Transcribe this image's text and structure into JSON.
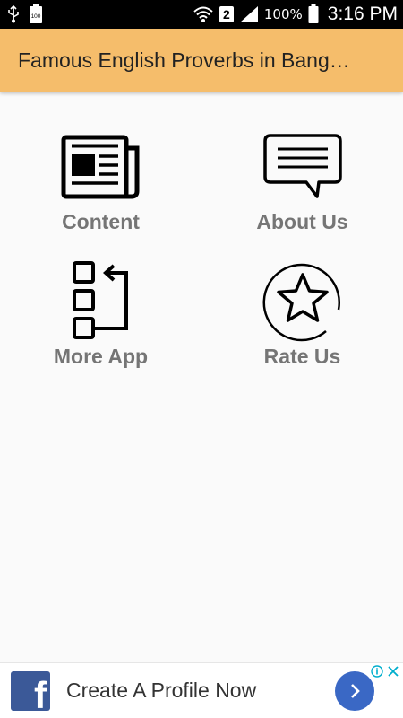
{
  "status_bar": {
    "left_icons": [
      "usb-icon",
      "battery-100-icon"
    ],
    "battery_small_label": "100",
    "sim_label": "2",
    "battery_percent": "100%",
    "time": "3:16 PM"
  },
  "app_bar": {
    "title": "Famous English Proverbs in Bang…",
    "background": "#f5bd6b"
  },
  "menu": {
    "items": [
      {
        "label": "Content",
        "icon": "newspaper-icon"
      },
      {
        "label": "About Us",
        "icon": "chat-bubble-icon"
      },
      {
        "label": "More App",
        "icon": "app-list-icon"
      },
      {
        "label": "Rate Us",
        "icon": "star-circle-icon"
      }
    ],
    "label_color": "#757575"
  },
  "ad": {
    "brand_letter": "f",
    "text": "Create A Profile Now",
    "brand_color": "#3b5998",
    "cta_color": "#3a68c5"
  }
}
